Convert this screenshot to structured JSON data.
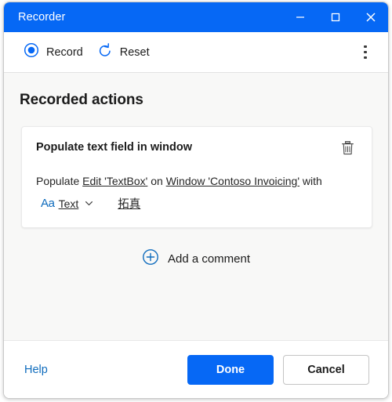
{
  "window": {
    "title": "Recorder",
    "controls": {
      "minimize": "minimize-icon",
      "maximize": "maximize-icon",
      "close": "close-icon"
    }
  },
  "toolbar": {
    "record_label": "Record",
    "record_icon": "record-circle-icon",
    "reset_label": "Reset",
    "reset_icon": "reset-arrow-icon",
    "overflow_icon": "more-vertical-icon"
  },
  "main": {
    "section_title": "Recorded actions",
    "action": {
      "title": "Populate text field in window",
      "delete_icon": "trash-icon",
      "desc_prefix": "Populate",
      "target_param": "Edit 'TextBox'",
      "desc_middle": "on",
      "window_param": "Window 'Contoso Invoicing'",
      "desc_suffix": "with",
      "type_icon": "text-format-icon",
      "type_icon_label": "Aa",
      "type_label": "Text",
      "type_chevron": "chevron-down-icon",
      "value_text": "拓真"
    },
    "add_comment": {
      "icon": "add-circle-icon",
      "label": "Add a comment"
    }
  },
  "footer": {
    "help_label": "Help",
    "done_label": "Done",
    "cancel_label": "Cancel"
  },
  "colors": {
    "accent": "#0668f5",
    "link": "#0f6cbd",
    "body_bg": "#f8f8f7",
    "card_bg": "#ffffff",
    "text": "#1b1b1b"
  }
}
